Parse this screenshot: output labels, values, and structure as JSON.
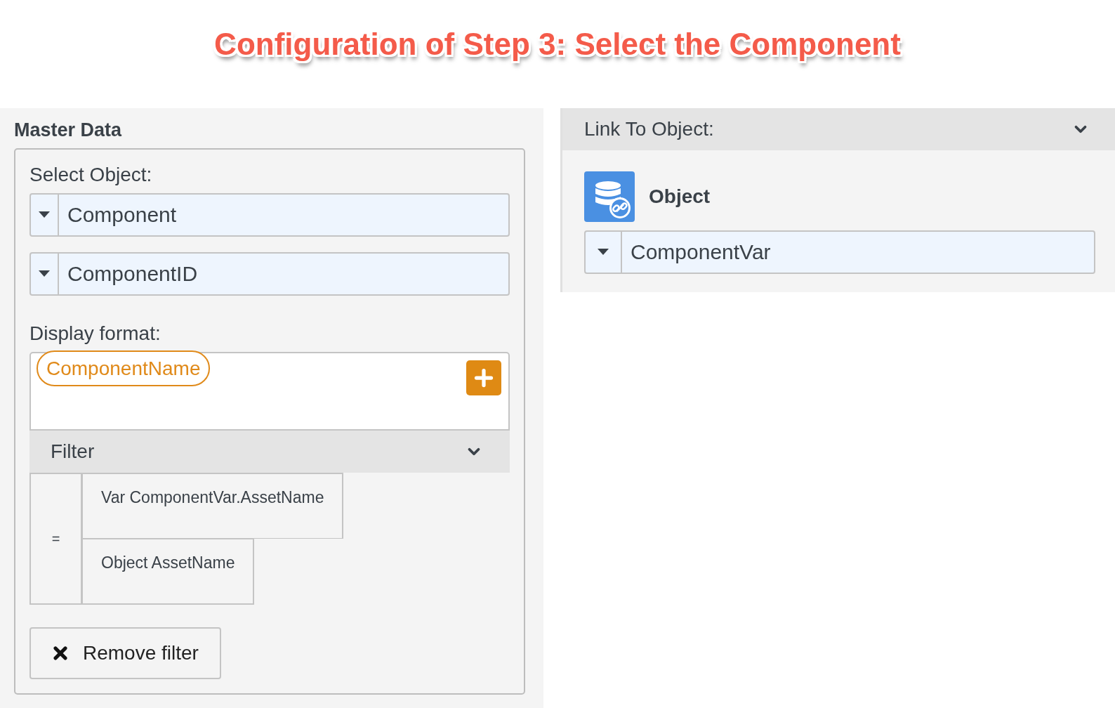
{
  "title": "Configuration of Step 3: Select the Component",
  "master_data": {
    "heading": "Master Data",
    "select_label": "Select Object:",
    "selects": [
      {
        "value": "Component"
      },
      {
        "value": "ComponentID"
      }
    ],
    "display_format": {
      "label": "Display format:",
      "tokens": [
        "ComponentName"
      ]
    },
    "filter": {
      "label": "Filter",
      "expanded": true,
      "operator": "=",
      "operands": [
        "Var ComponentVar.AssetName",
        "Object AssetName"
      ]
    },
    "remove_button": "Remove filter"
  },
  "link": {
    "header": "Link To Object:",
    "expanded": true,
    "object_label": "Object",
    "select": {
      "value": "ComponentVar"
    }
  }
}
